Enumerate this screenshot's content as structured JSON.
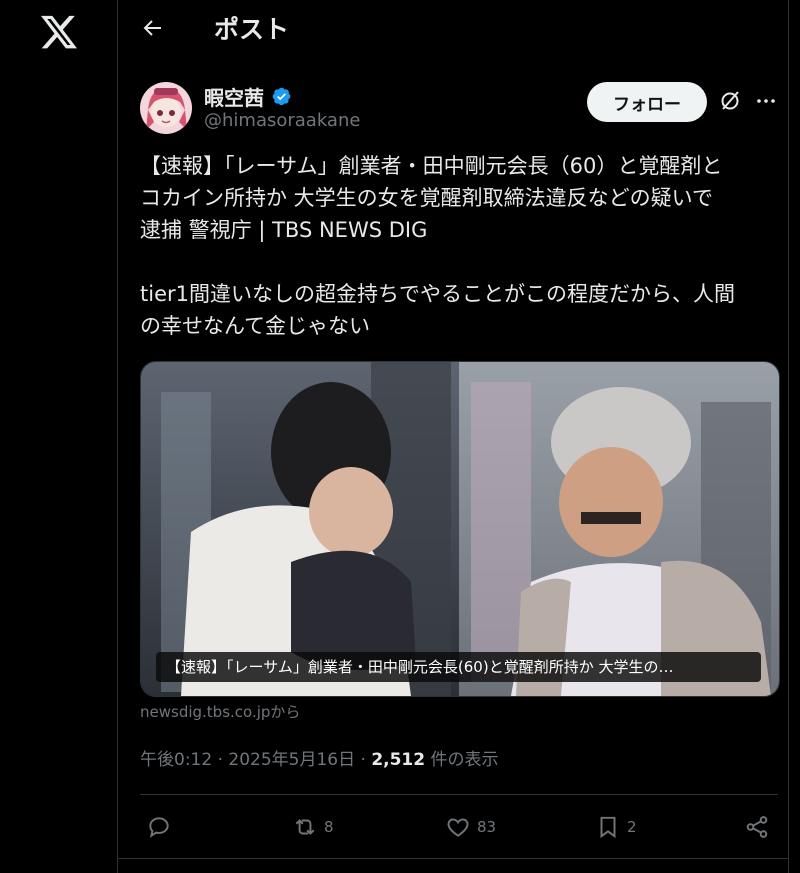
{
  "header": {
    "title": "ポスト"
  },
  "author": {
    "name": "暇空茜",
    "handle": "@himasoraakane",
    "follow_label": "フォロー"
  },
  "tweet": {
    "text": "【速報】「レーサム」創業者・田中剛元会長（60）と覚醒剤と\nコカイン所持か 大学生の女を覚醒剤取締法違反などの疑いで\n逮捕 警視庁 | TBS NEWS DIG\n\ntier1間違いなしの超金持ちでやることがこの程度だから、人間\nの幸せなんて金じゃない",
    "media_caption": "【速報】「レーサム」創業者・田中剛元会長(60)と覚醒剤所持か 大学生の…",
    "source": "newsdig.tbs.co.jpから"
  },
  "meta": {
    "time": "午後0:12 · 2025年5月16日 · ",
    "views": "2,512",
    "views_suffix": " 件の表示"
  },
  "actions": {
    "reposts": "8",
    "likes": "83",
    "bookmarks": "2"
  },
  "icons": [
    "x-logo",
    "back-arrow-icon",
    "verified-icon",
    "grok-icon",
    "more-icon",
    "reply-icon",
    "repost-icon",
    "like-icon",
    "bookmark-icon",
    "share-icon"
  ],
  "colors": {
    "background": "#000000",
    "text": "#e7e9ea",
    "muted": "#71767b",
    "verified": "#1d9bf0",
    "border": "#2f3336"
  }
}
